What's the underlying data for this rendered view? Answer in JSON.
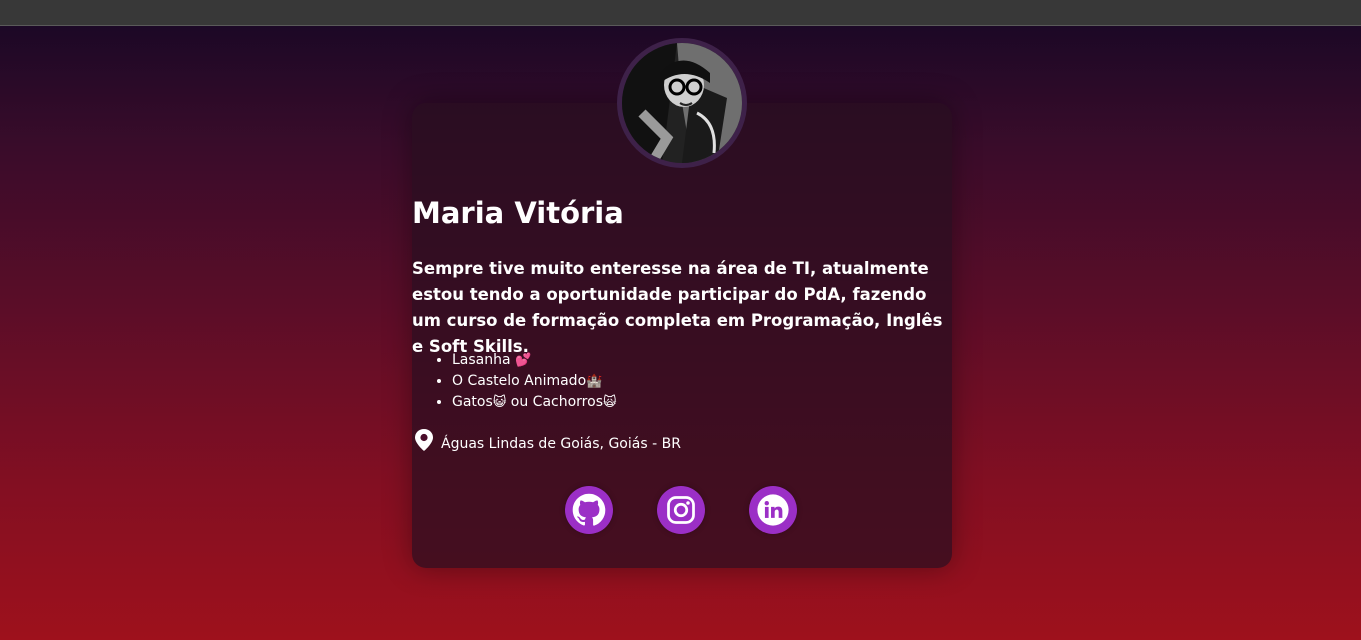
{
  "profile": {
    "name": "Maria Vitória",
    "bio": "Sempre tive muito enteresse na área de TI, atualmente estou tendo a oportunidade participar do PdA, fazendo um curso de formação completa em Programação, Inglês e Soft Skills.",
    "likes": [
      {
        "text": "Lasanha",
        "emoji": "💕"
      },
      {
        "text": "O Castelo Animado",
        "emoji": "🏰"
      },
      {
        "text": "Gatos",
        "emoji": "😺",
        "text2": "ou Cachorros",
        "emoji2": "🙀"
      }
    ],
    "location": "Águas Lindas de Goiás, Goiás - BR",
    "location_icon": "map-pin-icon"
  },
  "socials": [
    {
      "name": "GitHub",
      "icon": "github-icon"
    },
    {
      "name": "Instagram",
      "icon": "instagram-icon"
    },
    {
      "name": "LinkedIn",
      "icon": "linkedin-icon"
    }
  ],
  "colors": {
    "accent": "#9b2fc6",
    "card": "#2a0e22",
    "gradient_top": "#1c0826",
    "gradient_bottom": "#9e111c"
  }
}
